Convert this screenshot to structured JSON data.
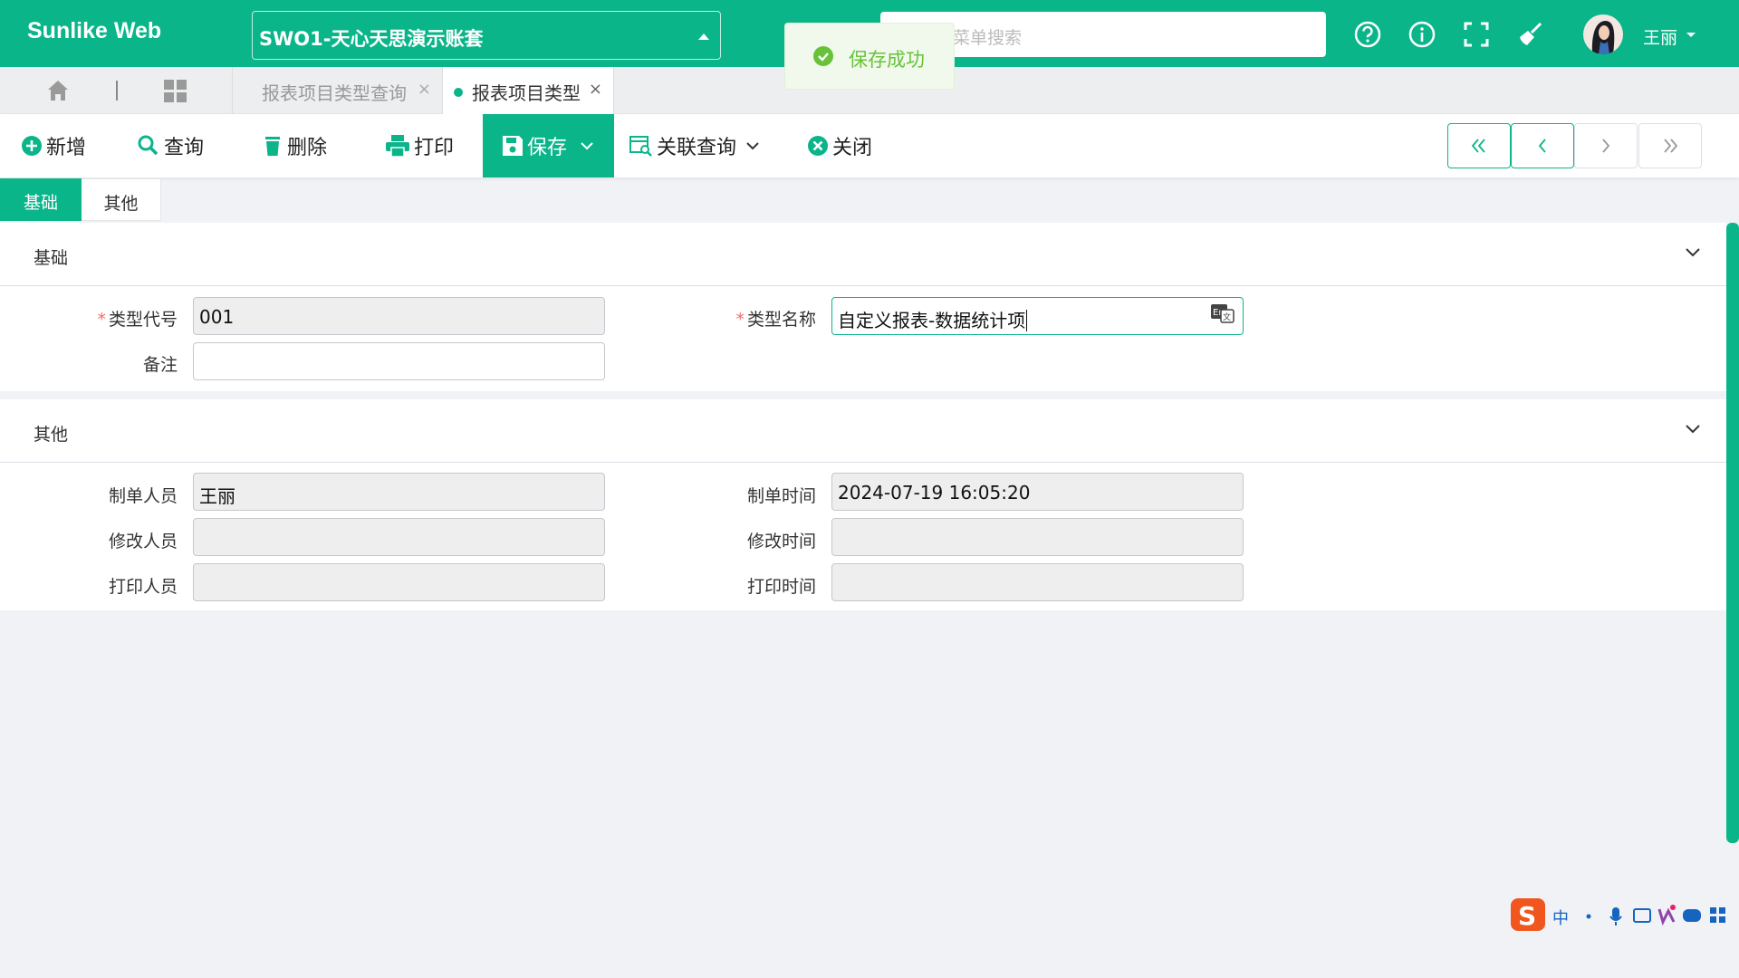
{
  "header": {
    "logo": "Sunlike Web",
    "account_selector": "SWO1-天心天思演示账套",
    "search_placeholder": "菜单搜索",
    "icons": [
      "help-icon",
      "info-icon",
      "fullscreen-icon",
      "broom-icon"
    ],
    "user_name": "王丽"
  },
  "toast": {
    "message": "保存成功"
  },
  "tabs": [
    {
      "label": "报表项目类型查询",
      "active": false
    },
    {
      "label": "报表项目类型",
      "active": true
    }
  ],
  "toolbar": {
    "new": "新增",
    "query": "查询",
    "delete": "删除",
    "print": "打印",
    "save": "保存",
    "related_query": "关联查询",
    "close": "关闭"
  },
  "form_tabs": [
    "基础",
    "其他"
  ],
  "basic_section": {
    "title": "基础",
    "type_code_label": "类型代号",
    "type_code_value": "001",
    "type_name_label": "类型名称",
    "type_name_value": "自定义报表-数据统计项",
    "remark_label": "备注",
    "remark_value": ""
  },
  "other_section": {
    "title": "其他",
    "creator_label": "制单人员",
    "creator_value": "王丽",
    "create_time_label": "制单时间",
    "create_time_value": "2024-07-19 16:05:20",
    "modifier_label": "修改人员",
    "modifier_value": "",
    "modify_time_label": "修改时间",
    "modify_time_value": "",
    "printer_label": "打印人员",
    "printer_value": "",
    "print_time_label": "打印时间",
    "print_time_value": ""
  },
  "ime": {
    "mode": "中"
  },
  "colors": {
    "primary": "#0ab58a",
    "success": "#67c23a",
    "required": "#f56c6c"
  }
}
